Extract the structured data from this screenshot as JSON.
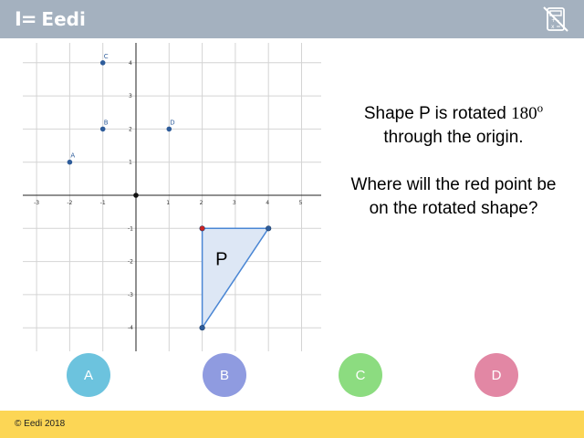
{
  "header": {
    "brand_mark": "I=",
    "brand_name": "Eedi",
    "calculator_icon": "calculator-crossed-icon"
  },
  "graph": {
    "x_ticks": [
      "-3",
      "-2",
      "-1",
      "1",
      "2",
      "3",
      "4",
      "5"
    ],
    "y_ticks": [
      "4",
      "3",
      "2",
      "1",
      "-1",
      "-2",
      "-3",
      "-4"
    ],
    "points": [
      {
        "label": "A",
        "x": -2,
        "y": 1
      },
      {
        "label": "B",
        "x": -1,
        "y": 2
      },
      {
        "label": "C",
        "x": -1,
        "y": 4
      },
      {
        "label": "D",
        "x": 1,
        "y": 2
      }
    ],
    "origin": {
      "x": 0,
      "y": 0
    },
    "shape": {
      "label": "P",
      "vertices": [
        [
          2,
          -1
        ],
        [
          4,
          -1
        ],
        [
          2,
          -4
        ]
      ],
      "red_point": [
        2,
        -1
      ]
    },
    "colors": {
      "point": "#2e5c9a",
      "red_point": "#cc2222",
      "shape_fill": "#dde7f5",
      "shape_stroke": "#4a86d4"
    }
  },
  "question": {
    "line1_pre": "Shape P is rotated ",
    "degrees": "180",
    "deg_sup": "o",
    "line2": "through the origin.",
    "line3": "Where will the red point be on the rotated shape?"
  },
  "answers": [
    {
      "label": "A",
      "color": "#6cc3de"
    },
    {
      "label": "B",
      "color": "#8f9be0"
    },
    {
      "label": "C",
      "color": "#8cdc80"
    },
    {
      "label": "D",
      "color": "#e287a4"
    }
  ],
  "footer": {
    "copyright": "© Eedi 2018"
  }
}
